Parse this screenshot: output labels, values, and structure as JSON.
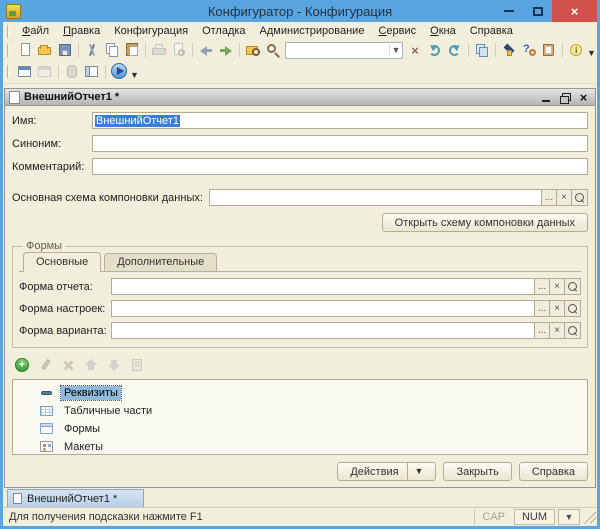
{
  "colors": {
    "titlebar": "#58a5e2",
    "close_button": "#d0514d",
    "background": "#f1eedc",
    "text_selection": "#3a7edb",
    "tree_selection": "#8fbade"
  },
  "window": {
    "title": "Конфигуратор - Конфигурация"
  },
  "menu": {
    "items": [
      {
        "label": "Файл",
        "hot": 0
      },
      {
        "label": "Правка",
        "hot": 0
      },
      {
        "label": "Конфигурация",
        "hot": -1
      },
      {
        "label": "Отладка",
        "hot": -1
      },
      {
        "label": "Администрирование",
        "hot": -1
      },
      {
        "label": "Сервис",
        "hot": 0
      },
      {
        "label": "Окна",
        "hot": 0
      },
      {
        "label": "Справка",
        "hot": -1
      }
    ]
  },
  "toolbar_main": {
    "search_value": "",
    "items": [
      "new-document",
      "open",
      "save",
      "|",
      "cut",
      "copy",
      "paste",
      "|",
      "print",
      "print-preview",
      "|",
      "undo",
      "redo",
      "|",
      "find",
      "zoom",
      "search",
      "clear-search",
      "back",
      "forward",
      "|",
      "windows",
      "|",
      "syntax-check",
      "help-search",
      "methods-book",
      "|",
      "info",
      "caret"
    ],
    "disabled": [
      "print",
      "print-preview"
    ]
  },
  "toolbar_config": {
    "items": [
      "config-window",
      "window-gray",
      "|",
      "database",
      "table-window",
      "|",
      "start-debug",
      "caret"
    ],
    "disabled": [
      "window-gray",
      "database"
    ]
  },
  "editor": {
    "title": "ВнешнийОтчет1 *",
    "name_label": "Имя:",
    "name_value": "ВнешнийОтчет1",
    "synonym_label": "Синоним:",
    "synonym_value": "",
    "comment_label": "Комментарий:",
    "comment_value": "",
    "dcs_label": "Основная схема компоновки данных:",
    "dcs_value": "",
    "open_dcs_button": "Открыть схему компоновки данных",
    "field_buttons": [
      "ellipsis",
      "clear",
      "magnifier"
    ],
    "forms": {
      "legend": "Формы",
      "tabs": [
        {
          "label": "Основные",
          "active": true
        },
        {
          "label": "Дополнительные",
          "active": false
        }
      ],
      "rows": [
        {
          "label": "Форма отчета:",
          "value": ""
        },
        {
          "label": "Форма настроек:",
          "value": ""
        },
        {
          "label": "Форма варианта:",
          "value": ""
        }
      ]
    },
    "tree_toolbar": {
      "items": [
        "add",
        "edit",
        "delete",
        "move-up",
        "move-down",
        "sort"
      ],
      "disabled": [
        "edit",
        "delete",
        "move-up",
        "move-down",
        "sort"
      ]
    },
    "tree": {
      "items": [
        {
          "label": "Реквизиты",
          "icon": "attributes",
          "selected": true
        },
        {
          "label": "Табличные части",
          "icon": "tabular-sections",
          "selected": false
        },
        {
          "label": "Формы",
          "icon": "forms",
          "selected": false
        },
        {
          "label": "Макеты",
          "icon": "templates",
          "selected": false
        }
      ]
    },
    "footer": {
      "actions": "Действия",
      "close": "Закрыть",
      "help": "Справка"
    }
  },
  "taskbar": {
    "tabs": [
      {
        "label": "ВнешнийОтчет1 *",
        "active": true
      }
    ]
  },
  "statusbar": {
    "hint": "Для получения подсказки нажмите F1",
    "cap": "CAP",
    "num": "NUM"
  }
}
